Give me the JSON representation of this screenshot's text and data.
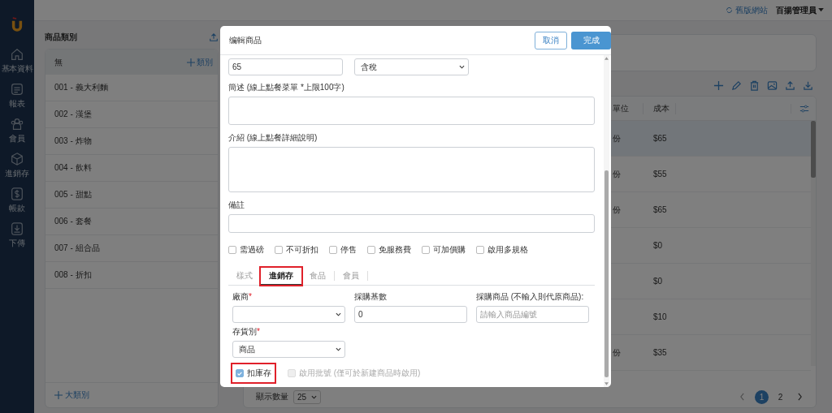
{
  "sidebar": {
    "items": [
      {
        "label": "基本資料"
      },
      {
        "label": "報表"
      },
      {
        "label": "會員"
      },
      {
        "label": "進銷存"
      },
      {
        "label": "帳款"
      },
      {
        "label": "下傳"
      }
    ]
  },
  "topbar": {
    "legacy_link": "舊版網站",
    "user": "百揚管理員"
  },
  "category_panel": {
    "title": "商品類別",
    "header": {
      "label": "無",
      "add_button": "類別"
    },
    "items": [
      {
        "label": "001 - 義大利麵"
      },
      {
        "label": "002 - 漢堡"
      },
      {
        "label": "003 - 炸物"
      },
      {
        "label": "004 - 飲料"
      },
      {
        "label": "005 - 甜點"
      },
      {
        "label": "006 - 套餐"
      },
      {
        "label": "007 - 組合品"
      },
      {
        "label": "008 - 折扣"
      }
    ],
    "add_major": "大類別"
  },
  "product_table": {
    "columns": [
      {
        "label": "單位"
      },
      {
        "label": "成本"
      }
    ],
    "rows": [
      {
        "unit": "份",
        "cost": "$65",
        "selected": true
      },
      {
        "unit": "份",
        "cost": "$55",
        "selected": false
      },
      {
        "unit": "份",
        "cost": "$65",
        "selected": false
      },
      {
        "cost": "$0",
        "selected": false
      },
      {
        "cost": "$0",
        "selected": false
      },
      {
        "cost": "$10",
        "selected": false
      },
      {
        "unit": "份",
        "cost": "$35",
        "selected": false
      }
    ],
    "page_size_label": "顯示數量",
    "page_size": "25",
    "pages": [
      {
        "label": "1",
        "selected": true
      },
      {
        "label": "2",
        "selected": false
      }
    ]
  },
  "modal": {
    "title": "编輯商品",
    "cancel": "取消",
    "confirm": "完成",
    "price": "65",
    "tax": "含稅",
    "summary_label": "簡述 (線上點餐菜單 *上限100字)",
    "intro_label": "介紹 (線上點餐詳細說明)",
    "note_label": "備註",
    "options": [
      {
        "label": "需過磅",
        "checked": false
      },
      {
        "label": "不可折扣",
        "checked": false
      },
      {
        "label": "停售",
        "checked": false
      },
      {
        "label": "免服務費",
        "checked": false
      },
      {
        "label": "可加價購",
        "checked": false
      },
      {
        "label": "啟用多規格",
        "checked": false
      }
    ],
    "tabs": [
      {
        "label": "樣式",
        "selected": false,
        "highlighted": false
      },
      {
        "label": "進銷存",
        "selected": true,
        "highlighted": true
      },
      {
        "label": "食品",
        "selected": false,
        "highlighted": false
      },
      {
        "label": "會員",
        "selected": false,
        "highlighted": false
      }
    ],
    "inventory_fields": [
      {
        "kind": "select",
        "label": "廠商",
        "required_mark": "*"
      },
      {
        "kind": "input",
        "label": "採購基數",
        "value": "0"
      },
      {
        "kind": "input",
        "label": "採購商品 (不輸入則代原商品):",
        "placeholder": "請輸入商品編號"
      },
      {
        "kind": "select",
        "label": "存貨別",
        "required_mark": "*",
        "value": "商品"
      }
    ],
    "stock_options": [
      {
        "label": "扣庫存",
        "checked": true,
        "disabled": false,
        "highlighted": true
      },
      {
        "label": "啟用批號 (僅可於新建商品時啟用)",
        "checked": false,
        "disabled": true,
        "highlighted": false
      }
    ]
  }
}
